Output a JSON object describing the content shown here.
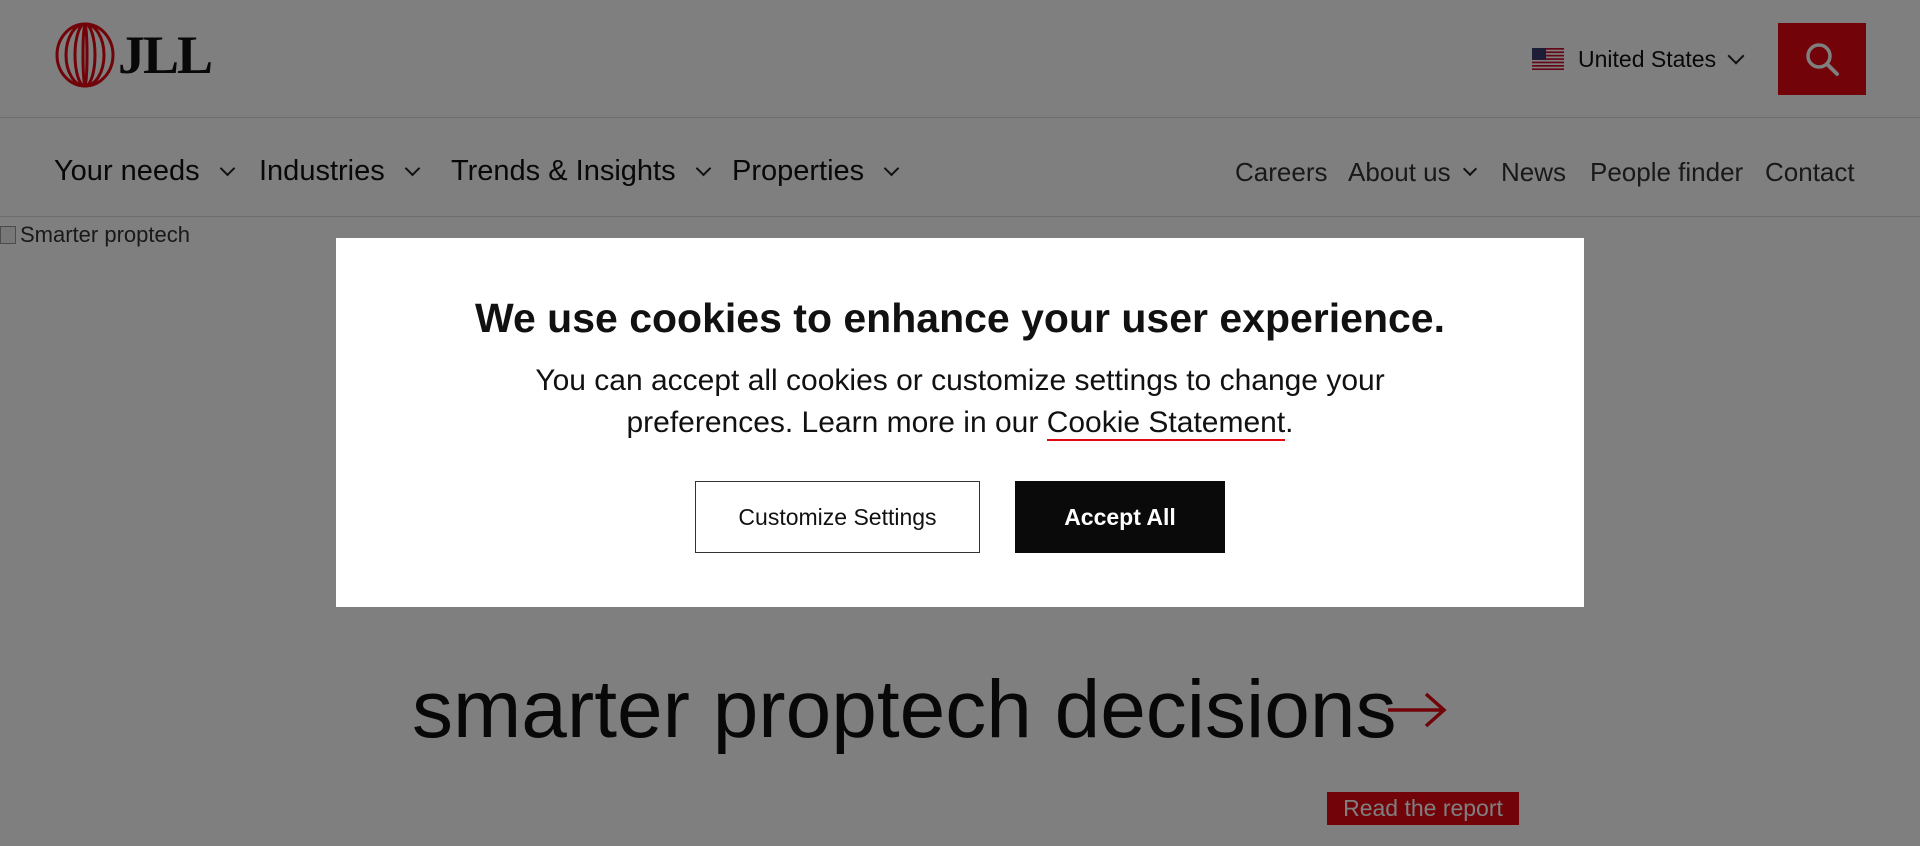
{
  "header": {
    "logo_text": "JLL",
    "country": "United States",
    "brand_color": "#e30613"
  },
  "nav": {
    "primary": [
      {
        "label": "Your needs"
      },
      {
        "label": "Industries"
      },
      {
        "label": "Trends & Insights"
      },
      {
        "label": "Properties"
      }
    ],
    "secondary": [
      {
        "label": "Careers"
      },
      {
        "label": "About us"
      },
      {
        "label": "News"
      },
      {
        "label": "People finder"
      },
      {
        "label": "Contact"
      }
    ]
  },
  "hero": {
    "image_alt": "Smarter proptech",
    "headline": "smarter proptech decisions",
    "cta": "Read the report"
  },
  "cookie_modal": {
    "title": "We use cookies to enhance your user experience.",
    "body_prefix": "You can accept all cookies or customize settings to change your preferences. Learn more in our ",
    "link_text": "Cookie Statement",
    "body_suffix": ".",
    "customize_label": "Customize Settings",
    "accept_label": "Accept All"
  }
}
